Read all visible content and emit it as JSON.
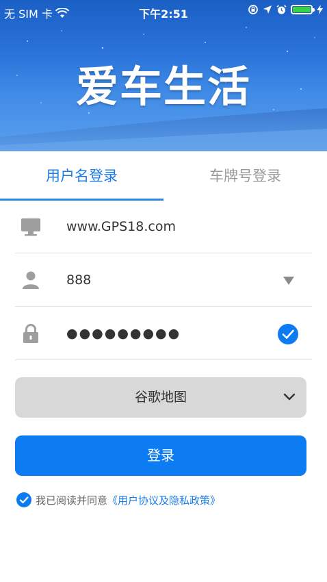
{
  "status_bar": {
    "carrier": "无 SIM 卡",
    "time": "下午2:51",
    "icons": [
      "wifi-icon",
      "rotation-lock-icon",
      "location-arrow-icon",
      "alarm-icon",
      "battery-icon",
      "charging-bolt-icon"
    ]
  },
  "header": {
    "title": "爱车生活"
  },
  "tabs": [
    {
      "label": "用户名登录",
      "active": true
    },
    {
      "label": "车牌号登录",
      "active": false
    }
  ],
  "form": {
    "server": {
      "value": "www.GPS18.com",
      "icon": "monitor-icon"
    },
    "username": {
      "value": "888",
      "icon": "user-icon",
      "trailing_icon": "dropdown-triangle-icon"
    },
    "password": {
      "value": "●●●●●●●●●",
      "icon": "lock-icon",
      "trailing_icon": "check-circle-icon"
    }
  },
  "map_select": {
    "selected": "谷歌地图",
    "icon": "chevron-down-icon"
  },
  "login_button": {
    "label": "登录"
  },
  "agreement": {
    "prefix": "我已阅读并同意",
    "link": "《用户协议及隐私政策》",
    "checked": true
  },
  "colors": {
    "accent": "#0d7cf2",
    "tab_active": "#1a7be6",
    "tab_inactive": "#9a9a9a",
    "select_bg": "#d8d8d8",
    "banner": "#2a73da"
  }
}
